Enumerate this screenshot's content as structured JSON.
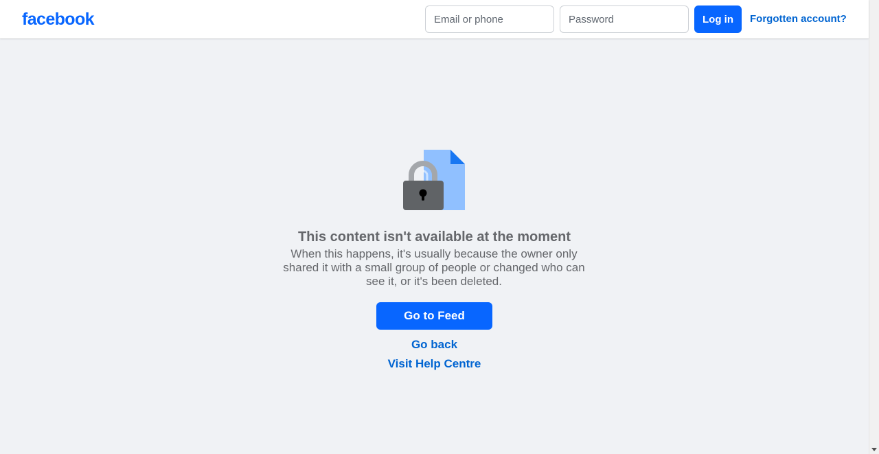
{
  "header": {
    "logo_text": "facebook",
    "email_placeholder": "Email or phone",
    "password_placeholder": "Password",
    "login_label": "Log in",
    "forgot_label": "Forgotten account?"
  },
  "main": {
    "icon": "locked-document-icon",
    "title": "This content isn't available at the moment",
    "description": "When this happens, it's usually because the owner only shared it with a small group of people or changed who can see it, or it's been deleted.",
    "primary_button": "Go to Feed",
    "go_back_link": "Go back",
    "help_link": "Visit Help Centre"
  },
  "colors": {
    "brand_blue": "#0866ff",
    "link_blue": "#0064d1",
    "page_bg": "#f0f2f5",
    "muted_text": "#65676b"
  }
}
